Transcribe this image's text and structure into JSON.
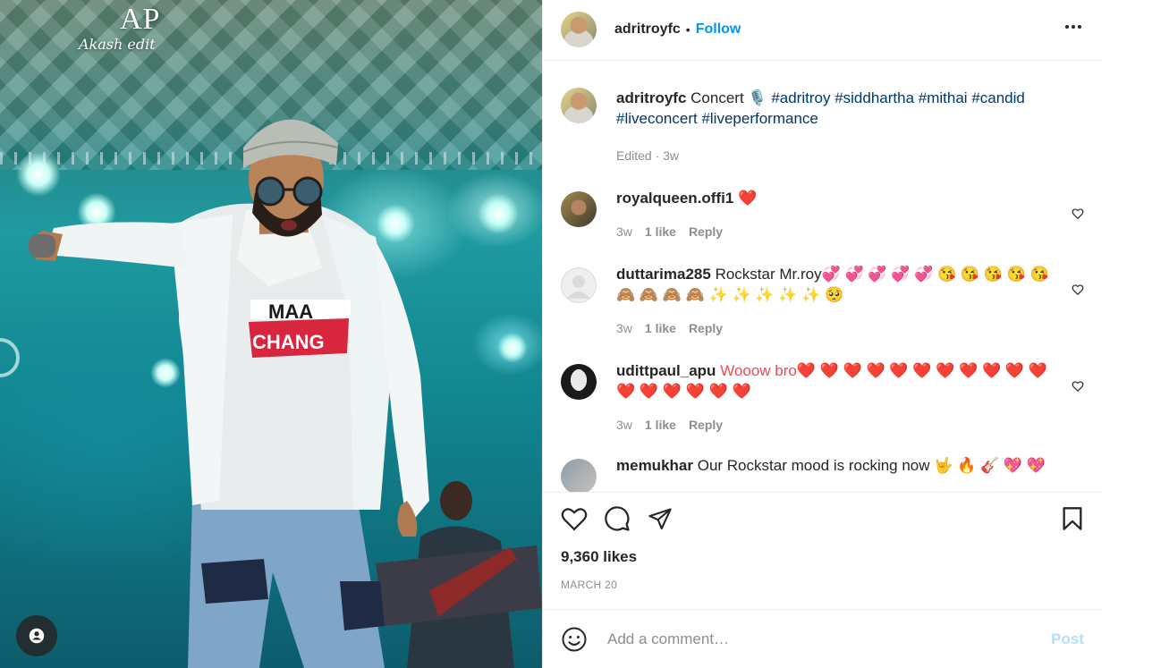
{
  "media": {
    "watermark_logo": "AP",
    "watermark_sub": "Akash edit",
    "tag_icon": "user-tag-icon",
    "shirt_text_1": "MAA",
    "shirt_text_2": "CHANG"
  },
  "header": {
    "username": "adritroyfc",
    "separator": "•",
    "follow_label": "Follow",
    "more_icon": "more-horizontal-icon"
  },
  "caption": {
    "username": "adritroyfc",
    "text": "Concert 🎙️",
    "hashtags": [
      "#adritroy",
      "#siddhartha",
      "#mithai",
      "#candid",
      "#liveconcert",
      "#liveperformance"
    ],
    "meta": "Edited · 3w"
  },
  "comments": [
    {
      "username": "royalqueen.offi1",
      "text": "❤️",
      "time": "3w",
      "likes": "1 like",
      "reply": "Reply"
    },
    {
      "username": "duttarima285",
      "text": "Rockstar Mr.roy💞 💞 💞 💞 💞 😘 😘 😘 😘 😘",
      "text2": "🙈 🙈 🙈 🙈 ✨ ✨ ✨ ✨ ✨ 🥺",
      "time": "3w",
      "likes": "1 like",
      "reply": "Reply"
    },
    {
      "username": "udittpaul_apu",
      "text": "Wooow bro❤️ ❤️ ❤️ ❤️ ❤️ ❤️ ❤️ ❤️ ❤️ ❤️ ❤️",
      "text2": "❤️ ❤️ ❤️ ❤️ ❤️ ❤️",
      "time": "3w",
      "likes": "1 like",
      "reply": "Reply"
    },
    {
      "username": "memukhar",
      "text": "Our Rockstar mood is rocking now 🤟 🔥 🎸 💖 💖"
    }
  ],
  "actions": {
    "like_icon": "heart-icon",
    "comment_icon": "comment-icon",
    "share_icon": "send-icon",
    "save_icon": "bookmark-icon"
  },
  "likes": "9,360 likes",
  "date": "MARCH 20",
  "add_comment": {
    "emoji_icon": "emoji-icon",
    "placeholder": "Add a comment…",
    "post_label": "Post"
  },
  "colors": {
    "accent": "#0095f6",
    "post_disabled": "#b2dffc",
    "hashtag": "#00376b",
    "secondary_text": "#8e8e8e"
  }
}
